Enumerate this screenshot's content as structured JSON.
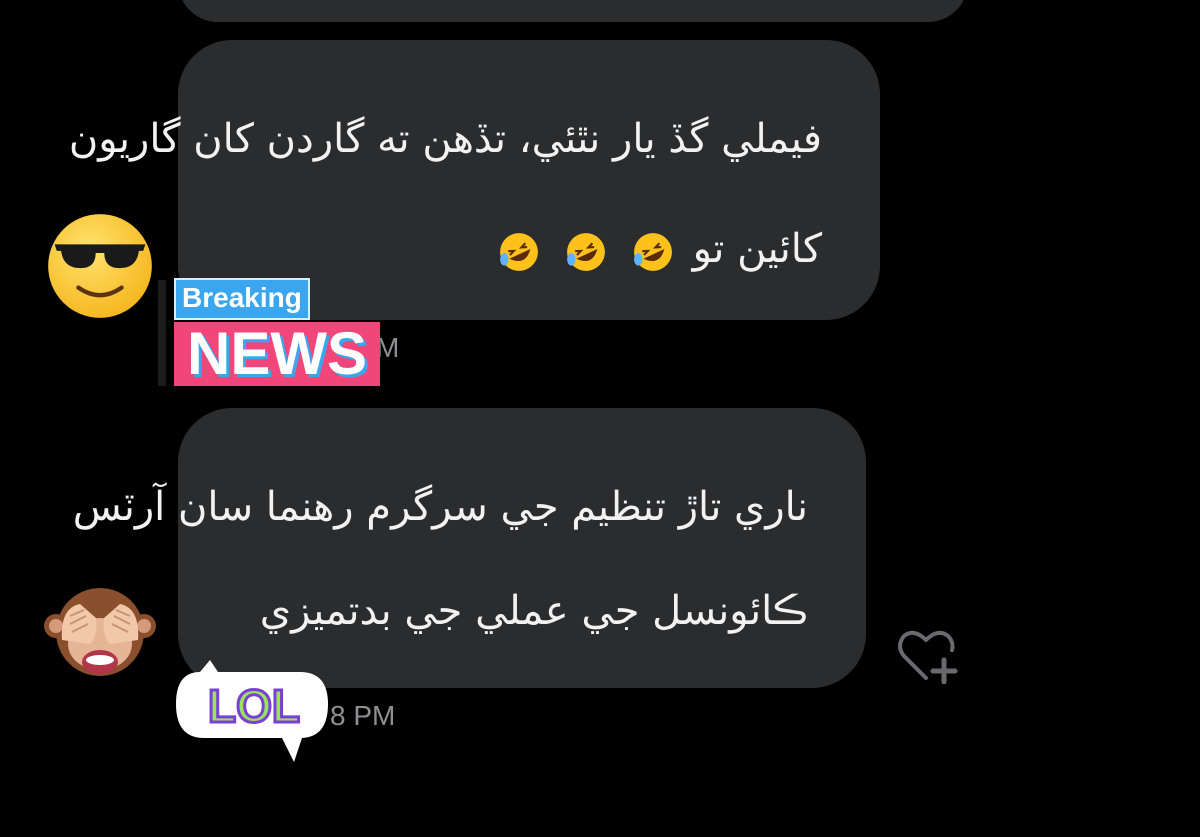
{
  "messages": [
    {
      "lines": [
        "فيملي گڏ يار نٿئي، تڏهن ته گاردن کان گاريون",
        "کائين تو"
      ],
      "reaction_emoji": "rolling-on-floor-laughing",
      "emoji_count": 3
    },
    {
      "lines": [
        "ناري تاڙ تنظيم جي سرگرم رهنما سان آرٽس",
        "ڪائونسل جي عملي جي بدتميزي"
      ]
    }
  ],
  "avatars": [
    {
      "icon": "smiling-face-with-sunglasses-icon"
    },
    {
      "icon": "see-no-evil-monkey-icon"
    }
  ],
  "timestamps": [
    "M",
    "8 PM"
  ],
  "stickers": {
    "breaking_text": "Breaking",
    "news_text": "NEWS",
    "lol_text": "LOL"
  },
  "colors": {
    "background": "#000000",
    "bubble": "#2b2c2e",
    "timestamp": "#8e8e93",
    "breaking_blue": "#3aa6f0",
    "news_pink": "#f0467a",
    "lol_purple": "#7a3fd6",
    "lol_green": "#9be35a"
  }
}
